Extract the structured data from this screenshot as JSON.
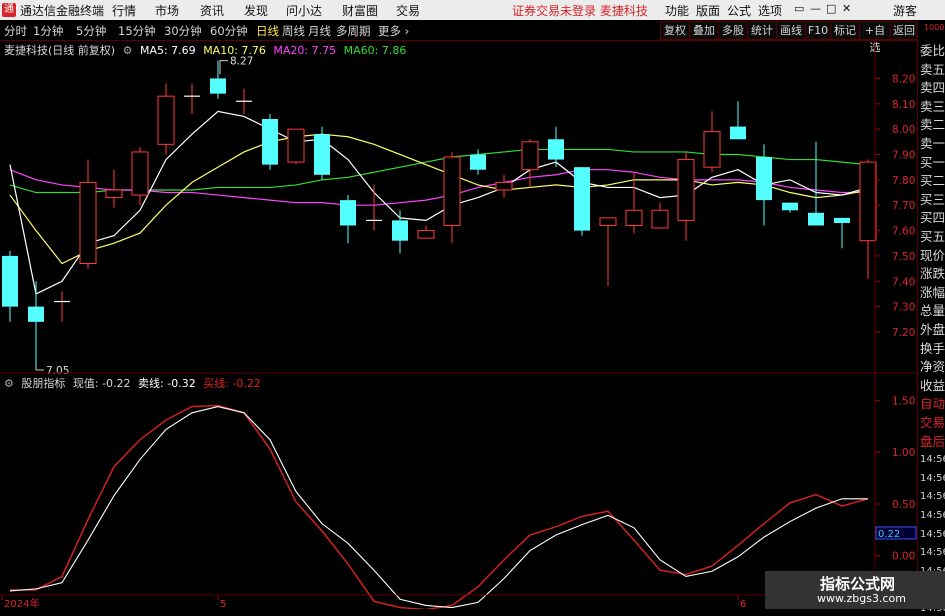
{
  "topbar": {
    "logo_glyph": "通",
    "app_title": "通达信金融终端",
    "menus": [
      "行情",
      "市场",
      "资讯",
      "发现",
      "问小达",
      "财富圈",
      "交易"
    ],
    "warning": "证券交易未登录  麦捷科技",
    "right_menus": [
      "功能",
      "版面",
      "公式",
      "选项"
    ],
    "user": "游客",
    "window_controls": [
      "▭",
      "—",
      "□",
      "✕"
    ]
  },
  "periods": [
    "分时",
    "1分钟",
    "5分钟",
    "15分钟",
    "30分钟",
    "60分钟",
    "日线",
    "周线",
    "月线",
    "多周期",
    "更多"
  ],
  "active_period": "日线",
  "toolbar_buttons": [
    "复权",
    "叠加",
    "多股",
    "统计",
    "画线",
    "F10",
    "标记",
    "+自选",
    "返回"
  ],
  "main_legend": {
    "stock": "麦捷科技(日线 前复权)",
    "ma5": "MA5: 7.69",
    "ma10": "MA10: 7.76",
    "ma20": "MA20: 7.75",
    "ma60": "MA60: 7.86"
  },
  "indicator_legend": {
    "name": "股朋指标",
    "current": "现值: -0.22",
    "sell_line": "卖线: -0.32",
    "buy_line": "买线: -0.22"
  },
  "price_axis": [
    "8.20",
    "8.10",
    "8.00",
    "7.90",
    "7.80",
    "7.70",
    "7.60",
    "7.50",
    "7.40",
    "7.30",
    "7.20"
  ],
  "indicator_axis": [
    "1.50",
    "1.00",
    "0.50",
    "0.00"
  ],
  "indicator_current_label": "0.22",
  "date_axis": [
    "2024年",
    "5",
    "6"
  ],
  "high_marker": "8.27",
  "low_marker": "7.05",
  "side_labels": [
    "委比",
    "卖五",
    "卖四",
    "卖三",
    "卖二",
    "卖一",
    "买一",
    "买二",
    "买三",
    "买四",
    "买五",
    "现价",
    "涨跌",
    "涨幅",
    "总量",
    "外盘",
    "换手",
    "净资",
    "收益",
    "自动",
    "交易",
    "盘后",
    "14:56",
    "14:56",
    "14:56",
    "14:56",
    "14:56",
    "14:56",
    "14:56",
    "14:56",
    "14:56"
  ],
  "side_top": "1000",
  "colors": {
    "up": "#ff3b3b",
    "down": "#54ffff",
    "ma5": "#ffffff",
    "ma10": "#ffff66",
    "ma20": "#ff44ff",
    "ma60": "#33dd33",
    "grid": "#5a0000",
    "sell_line": "#ffffff",
    "buy_line": "#e02020"
  },
  "chart_data": {
    "type": "candlestick",
    "ylim": [
      7.05,
      8.32
    ],
    "candles": [
      {
        "o": 7.5,
        "h": 7.52,
        "l": 7.24,
        "c": 7.3
      },
      {
        "o": 7.3,
        "h": 7.4,
        "l": 7.05,
        "c": 7.24
      },
      {
        "o": 7.32,
        "h": 7.36,
        "l": 7.24,
        "c": 7.32
      },
      {
        "o": 7.47,
        "h": 7.88,
        "l": 7.45,
        "c": 7.79
      },
      {
        "o": 7.73,
        "h": 7.84,
        "l": 7.69,
        "c": 7.76
      },
      {
        "o": 7.74,
        "h": 7.93,
        "l": 7.7,
        "c": 7.91
      },
      {
        "o": 7.94,
        "h": 8.18,
        "l": 7.9,
        "c": 8.13
      },
      {
        "o": 8.13,
        "h": 8.18,
        "l": 8.06,
        "c": 8.13
      },
      {
        "o": 8.2,
        "h": 8.27,
        "l": 8.12,
        "c": 8.14
      },
      {
        "o": 8.11,
        "h": 8.16,
        "l": 8.06,
        "c": 8.11
      },
      {
        "o": 8.04,
        "h": 8.06,
        "l": 7.84,
        "c": 7.86
      },
      {
        "o": 7.87,
        "h": 8.0,
        "l": 7.86,
        "c": 8.0
      },
      {
        "o": 7.98,
        "h": 8.01,
        "l": 7.8,
        "c": 7.82
      },
      {
        "o": 7.72,
        "h": 7.74,
        "l": 7.55,
        "c": 7.62
      },
      {
        "o": 7.64,
        "h": 7.78,
        "l": 7.6,
        "c": 7.64
      },
      {
        "o": 7.64,
        "h": 7.68,
        "l": 7.51,
        "c": 7.56
      },
      {
        "o": 7.57,
        "h": 7.62,
        "l": 7.57,
        "c": 7.6
      },
      {
        "o": 7.62,
        "h": 7.91,
        "l": 7.55,
        "c": 7.89
      },
      {
        "o": 7.9,
        "h": 7.92,
        "l": 7.82,
        "c": 7.84
      },
      {
        "o": 7.76,
        "h": 7.82,
        "l": 7.73,
        "c": 7.79
      },
      {
        "o": 7.84,
        "h": 7.96,
        "l": 7.77,
        "c": 7.95
      },
      {
        "o": 7.96,
        "h": 8.01,
        "l": 7.85,
        "c": 7.88
      },
      {
        "o": 7.85,
        "h": 7.85,
        "l": 7.58,
        "c": 7.6
      },
      {
        "o": 7.62,
        "h": 7.65,
        "l": 7.38,
        "c": 7.65
      },
      {
        "o": 7.62,
        "h": 7.83,
        "l": 7.59,
        "c": 7.68
      },
      {
        "o": 7.61,
        "h": 7.71,
        "l": 7.61,
        "c": 7.68
      },
      {
        "o": 7.64,
        "h": 7.91,
        "l": 7.56,
        "c": 7.88
      },
      {
        "o": 7.85,
        "h": 8.07,
        "l": 7.83,
        "c": 7.99
      },
      {
        "o": 8.01,
        "h": 8.11,
        "l": 7.96,
        "c": 7.96
      },
      {
        "o": 7.89,
        "h": 7.94,
        "l": 7.62,
        "c": 7.72
      },
      {
        "o": 7.71,
        "h": 7.71,
        "l": 7.67,
        "c": 7.68
      },
      {
        "o": 7.67,
        "h": 7.95,
        "l": 7.64,
        "c": 7.62
      },
      {
        "o": 7.65,
        "h": 7.65,
        "l": 7.53,
        "c": 7.63
      },
      {
        "o": 7.56,
        "h": 7.88,
        "l": 7.41,
        "c": 7.87
      }
    ],
    "ma5": [
      7.86,
      7.35,
      7.4,
      7.55,
      7.58,
      7.68,
      7.88,
      7.98,
      8.07,
      8.05,
      8.0,
      7.95,
      7.96,
      7.88,
      7.75,
      7.65,
      7.64,
      7.7,
      7.73,
      7.77,
      7.84,
      7.87,
      7.79,
      7.77,
      7.77,
      7.73,
      7.74,
      7.81,
      7.84,
      7.78,
      7.8,
      7.75,
      7.74,
      7.77
    ],
    "ma10": [
      7.74,
      7.6,
      7.47,
      7.52,
      7.55,
      7.59,
      7.7,
      7.79,
      7.85,
      7.91,
      7.95,
      7.97,
      7.98,
      7.97,
      7.94,
      7.9,
      7.86,
      7.82,
      7.78,
      7.76,
      7.77,
      7.78,
      7.77,
      7.78,
      7.8,
      7.8,
      7.8,
      7.78,
      7.79,
      7.78,
      7.75,
      7.73,
      7.74,
      7.76
    ],
    "ma20": [
      7.84,
      7.8,
      7.78,
      7.77,
      7.76,
      7.76,
      7.75,
      7.75,
      7.74,
      7.73,
      7.72,
      7.71,
      7.71,
      7.7,
      7.7,
      7.71,
      7.72,
      7.74,
      7.77,
      7.79,
      7.81,
      7.82,
      7.84,
      7.84,
      7.83,
      7.81,
      7.8,
      7.8,
      7.8,
      7.79,
      7.77,
      7.76,
      7.75,
      7.75
    ],
    "ma60": [
      7.78,
      7.75,
      7.75,
      7.75,
      7.76,
      7.76,
      7.76,
      7.76,
      7.77,
      7.77,
      7.77,
      7.78,
      7.8,
      7.81,
      7.83,
      7.85,
      7.87,
      7.89,
      7.9,
      7.91,
      7.92,
      7.92,
      7.92,
      7.92,
      7.91,
      7.91,
      7.91,
      7.9,
      7.9,
      7.89,
      7.88,
      7.88,
      7.87,
      7.86
    ],
    "indicator": {
      "ylim": [
        -0.35,
        1.6
      ],
      "sell_line": [
        -0.34,
        -0.32,
        -0.26,
        0.15,
        0.58,
        0.93,
        1.22,
        1.38,
        1.44,
        1.38,
        1.12,
        0.62,
        0.31,
        0.12,
        -0.14,
        -0.42,
        -0.48,
        -0.5,
        -0.45,
        -0.22,
        0.05,
        0.2,
        0.3,
        0.39,
        0.27,
        -0.04,
        -0.2,
        -0.15,
        -0.01,
        0.18,
        0.33,
        0.46,
        0.55,
        0.55
      ],
      "buy_line": [
        -0.33,
        -0.33,
        -0.2,
        0.35,
        0.86,
        1.12,
        1.31,
        1.44,
        1.45,
        1.38,
        1.03,
        0.52,
        0.24,
        -0.08,
        -0.44,
        -0.5,
        -0.52,
        -0.48,
        -0.3,
        -0.04,
        0.2,
        0.28,
        0.38,
        0.43,
        0.15,
        -0.14,
        -0.18,
        -0.1,
        0.1,
        0.31,
        0.51,
        0.59,
        0.48,
        0.55
      ]
    }
  }
}
